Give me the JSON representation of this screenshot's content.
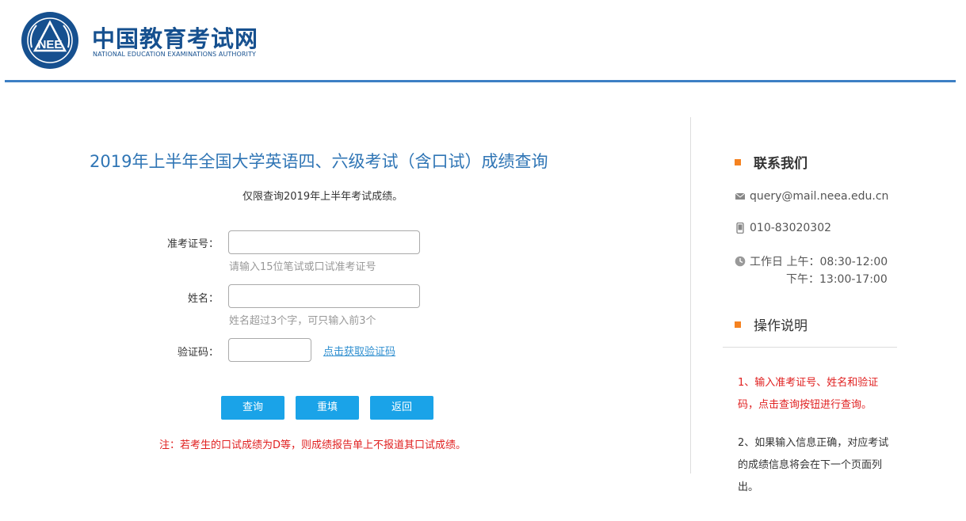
{
  "brand": {
    "emblem_text": "NEE",
    "name_cn": "中国教育考试网",
    "name_en": "NATIONAL EDUCATION EXAMINATIONS AUTHORITY"
  },
  "page": {
    "title": "2019年上半年全国大学英语四、六级考试（含口试）成绩查询",
    "limit_note": "仅限查询2019年上半年考试成绩。"
  },
  "form": {
    "ticket_label": "准考证号：",
    "ticket_value": "",
    "ticket_hint": "请输入15位笔试或口试准考证号",
    "name_label": "姓名：",
    "name_value": "",
    "name_hint": "姓名超过3个字，可只输入前3个",
    "captcha_label": "验证码：",
    "captcha_value": "",
    "captcha_link": "点击获取验证码"
  },
  "buttons": {
    "query": "查询",
    "reset": "重填",
    "back": "返回"
  },
  "remark": "注：若考生的口试成绩为D等，则成绩报告单上不报道其口试成绩。",
  "sidebar": {
    "contact_title": "联系我们",
    "email": "query@mail.neea.edu.cn",
    "phone": "010-83020302",
    "hours_am": "工作日 上午：08:30-12:00",
    "hours_pm": "下午：13:00-17:00",
    "instructions_title": "操作说明",
    "instruction_1": "1、输入准考证号、姓名和验证码，点击查询按钮进行查询。",
    "instruction_2": "2、如果输入信息正确，对应考试的成绩信息将会在下一个页面列出。"
  },
  "colors": {
    "brand_blue": "#16508f",
    "title_blue": "#2f75b5",
    "button_blue": "#1aa3e8",
    "accent_orange": "#f58220",
    "alert_red": "#e02020"
  }
}
